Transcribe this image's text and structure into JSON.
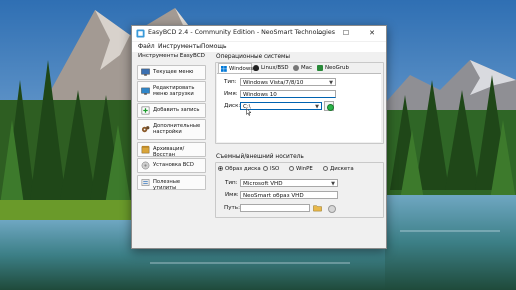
{
  "window": {
    "title": "EasyBCD 2.4 - Community Edition - NeoSmart Technologies",
    "controls": {
      "minimize": "—",
      "maximize": "☐",
      "close": "✕"
    }
  },
  "menu": [
    "Файл",
    "Инструменты",
    "Помощь"
  ],
  "sidebar": {
    "title": "Инструменты EasyBCD",
    "items": [
      {
        "label": "Текущее меню",
        "icon": "monitor-icon"
      },
      {
        "label": "Редактировать меню загрузки",
        "icon": "edit-menu-icon"
      },
      {
        "label": "Добавить запись",
        "icon": "add-entry-icon"
      },
      {
        "label": "Дополнительные настройки",
        "icon": "gears-icon"
      },
      {
        "label": "Архивация/Восстан",
        "icon": "archive-icon"
      },
      {
        "label": "Установка BCD",
        "icon": "install-icon"
      },
      {
        "label": "Полезные утилиты",
        "icon": "utilities-icon"
      }
    ]
  },
  "os_section": {
    "title": "Операционные системы",
    "tabs": [
      "Windows",
      "Linux/BSD",
      "Mac",
      "NeoGrub"
    ],
    "active_tab": "Windows",
    "type_label": "Тип:",
    "type_value": "Windows Vista/7/8/10",
    "name_label": "Имя:",
    "name_value": "Windows 10",
    "drive_label": "Диск:",
    "drive_value": "C:\\"
  },
  "removable_section": {
    "title": "Съемный/внешний носитель",
    "options": [
      "Образ диска",
      "ISO",
      "WinPE",
      "Дискета"
    ],
    "selected": "Образ диска",
    "type_label": "Тип:",
    "type_value": "Microsoft VHD",
    "name_label": "Имя:",
    "name_value": "NeoSmart образ VHD",
    "path_label": "Путь:",
    "path_value": ""
  }
}
